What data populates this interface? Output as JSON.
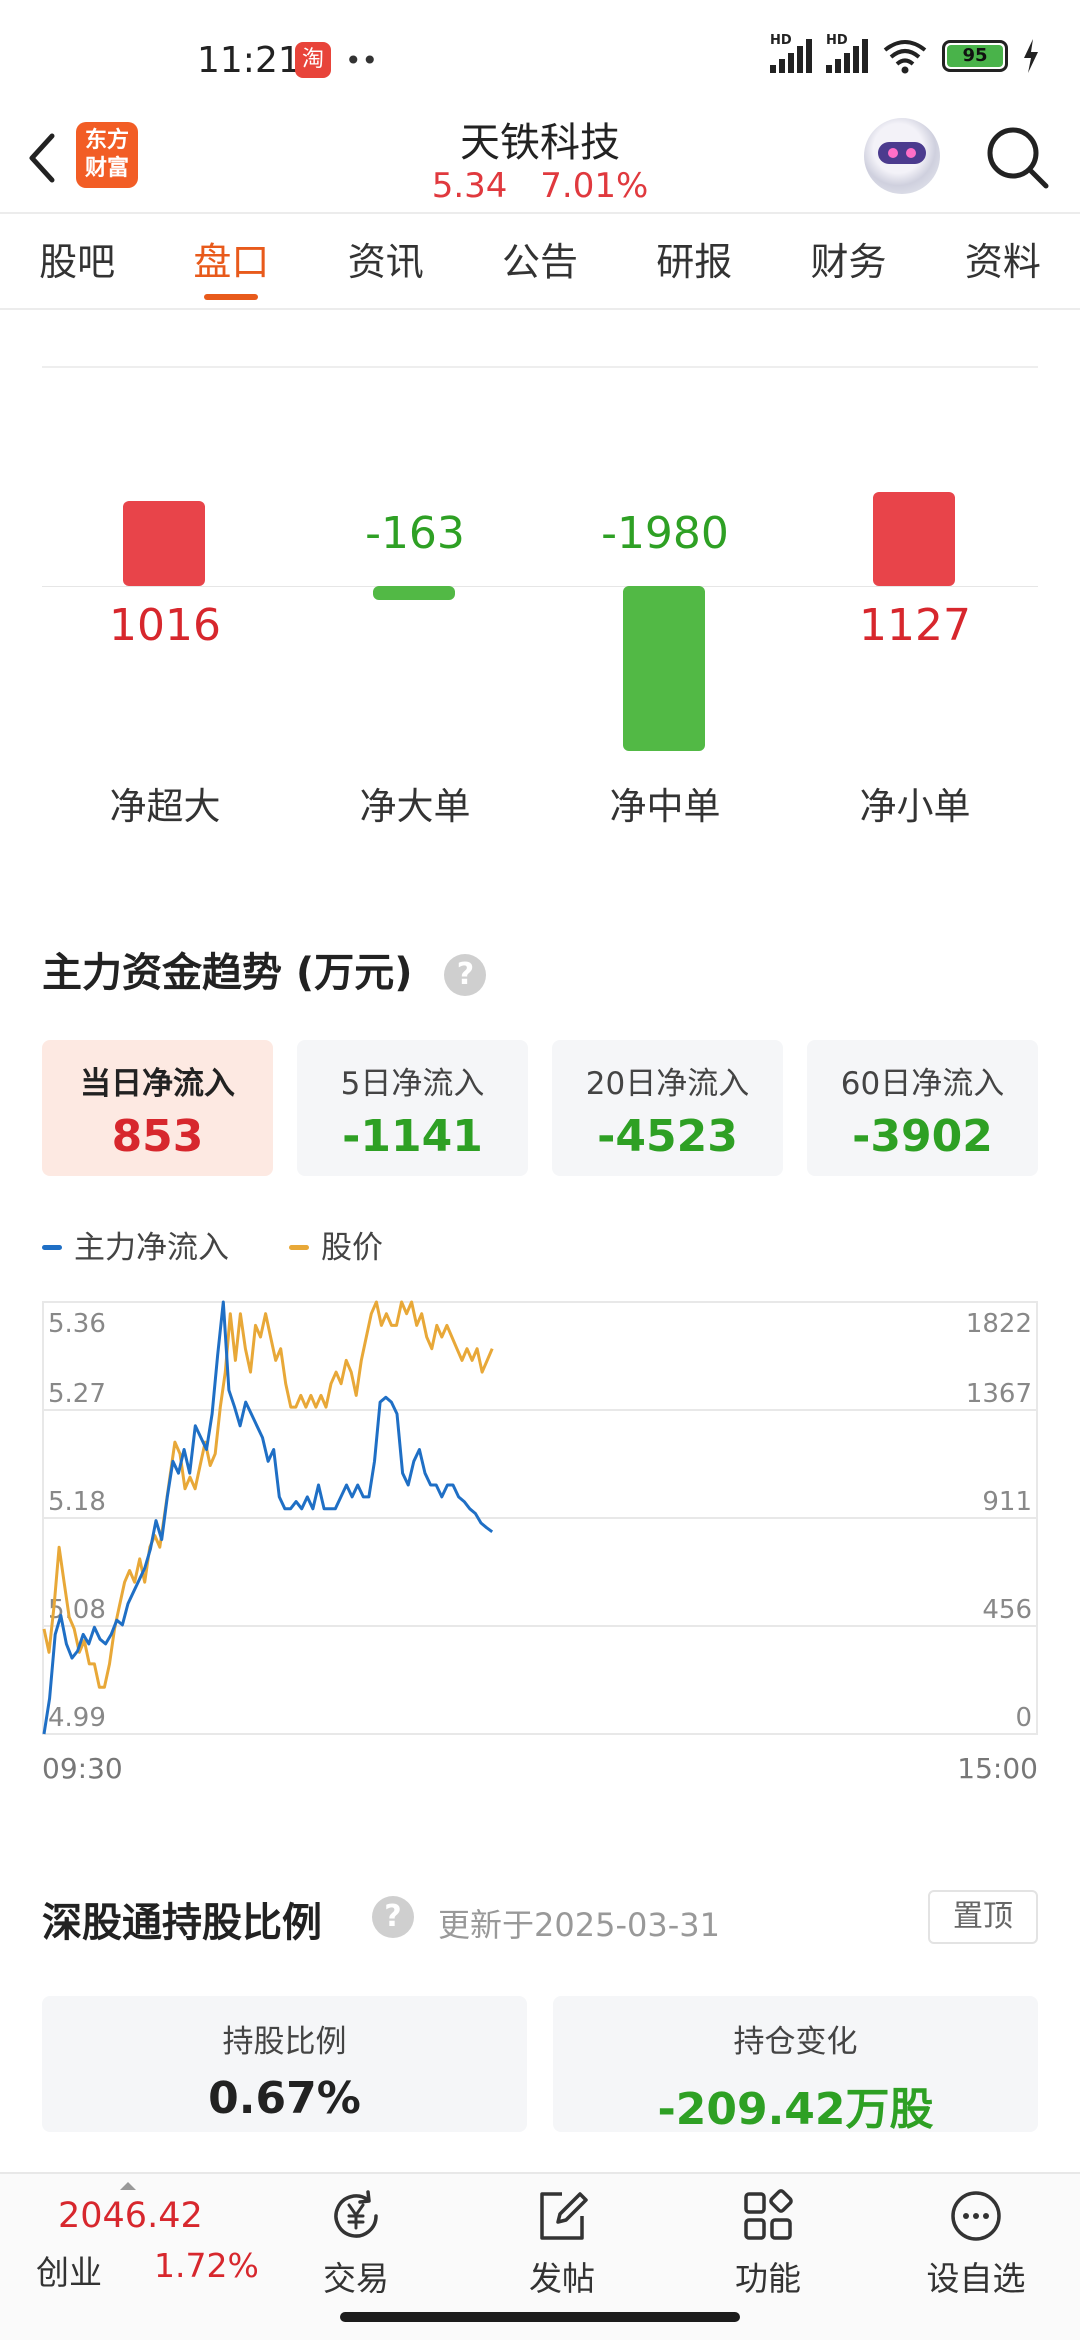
{
  "status_bar": {
    "time": "11:21",
    "app_icon": "淘",
    "dots": "••",
    "signal1_tag": "HD",
    "signal2_tag": "HD",
    "battery": "95",
    "icons": [
      "taobao-icon",
      "signal-icon",
      "signal-icon",
      "wifi-icon",
      "battery-icon",
      "charging-icon"
    ]
  },
  "header": {
    "brand_logo": "东方\n财富",
    "stock_name": "天铁科技",
    "price": "5.34",
    "change_pct": "7.01%",
    "icons": [
      "back-icon",
      "robot-avatar",
      "search-icon"
    ]
  },
  "tabs": [
    {
      "label": "股吧",
      "active": false
    },
    {
      "label": "盘口",
      "active": true
    },
    {
      "label": "资讯",
      "active": false
    },
    {
      "label": "公告",
      "active": false
    },
    {
      "label": "研报",
      "active": false
    },
    {
      "label": "财务",
      "active": false
    },
    {
      "label": "资料",
      "active": false
    }
  ],
  "flow": [
    {
      "label": "净超大",
      "value": "1016",
      "number": 1016,
      "sign": "pos"
    },
    {
      "label": "净大单",
      "value": "-163",
      "number": -163,
      "sign": "neg"
    },
    {
      "label": "净中单",
      "value": "-1980",
      "number": -1980,
      "sign": "neg"
    },
    {
      "label": "净小单",
      "value": "1127",
      "number": 1127,
      "sign": "pos"
    }
  ],
  "trend": {
    "title": "主力资金趋势 (万元)",
    "help": "?",
    "periods": [
      {
        "label": "当日净流入",
        "value": "853",
        "sign": "pos",
        "active": true
      },
      {
        "label": "5日净流入",
        "value": "-1141",
        "sign": "neg",
        "active": false
      },
      {
        "label": "20日净流入",
        "value": "-4523",
        "sign": "neg",
        "active": false
      },
      {
        "label": "60日净流入",
        "value": "-3902",
        "sign": "neg",
        "active": false
      }
    ],
    "legend": [
      {
        "label": "主力净流入",
        "color": "#1f6fc5"
      },
      {
        "label": "股价",
        "color": "#e8a838"
      }
    ],
    "time_start": "09:30",
    "time_end": "15:00"
  },
  "chart_data": {
    "type": "line",
    "xlabel": "",
    "ylabel": "",
    "x_range": [
      "09:30",
      "15:00"
    ],
    "ylim_left": [
      4.99,
      5.36
    ],
    "ylim_right": [
      0,
      1822
    ],
    "left_ticks": [
      "5.36",
      "5.27",
      "5.18",
      "5.08",
      "4.99"
    ],
    "right_ticks": [
      "1822",
      "1367",
      "911",
      "456",
      "0"
    ],
    "grid": true,
    "series": [
      {
        "name": "股价",
        "axis": "left",
        "color": "#e8a838",
        "values": [
          5.08,
          5.06,
          5.1,
          5.15,
          5.12,
          5.09,
          5.08,
          5.06,
          5.07,
          5.05,
          5.05,
          5.03,
          5.03,
          5.05,
          5.08,
          5.1,
          5.12,
          5.13,
          5.12,
          5.14,
          5.12,
          5.15,
          5.16,
          5.15,
          5.18,
          5.21,
          5.24,
          5.23,
          5.2,
          5.21,
          5.2,
          5.22,
          5.24,
          5.22,
          5.23,
          5.27,
          5.3,
          5.35,
          5.31,
          5.35,
          5.32,
          5.3,
          5.34,
          5.33,
          5.35,
          5.33,
          5.31,
          5.32,
          5.29,
          5.27,
          5.27,
          5.28,
          5.27,
          5.28,
          5.27,
          5.28,
          5.27,
          5.29,
          5.3,
          5.29,
          5.31,
          5.3,
          5.28,
          5.31,
          5.33,
          5.35,
          5.36,
          5.34,
          5.35,
          5.34,
          5.34,
          5.36,
          5.35,
          5.36,
          5.34,
          5.35,
          5.33,
          5.32,
          5.34,
          5.33,
          5.34,
          5.33,
          5.32,
          5.31,
          5.32,
          5.31,
          5.32,
          5.3,
          5.31,
          5.32
        ]
      },
      {
        "name": "主力净流入",
        "axis": "right",
        "color": "#1f6fc5",
        "values": [
          0,
          150,
          420,
          500,
          380,
          320,
          350,
          420,
          380,
          450,
          400,
          380,
          420,
          480,
          460,
          550,
          600,
          650,
          700,
          780,
          900,
          820,
          1000,
          1150,
          1100,
          1200,
          1100,
          1300,
          1250,
          1200,
          1350,
          1600,
          1822,
          1450,
          1380,
          1300,
          1400,
          1350,
          1300,
          1250,
          1150,
          1200,
          1000,
          950,
          950,
          980,
          950,
          1000,
          950,
          1050,
          950,
          950,
          950,
          1000,
          1050,
          1000,
          1050,
          1000,
          1000,
          1150,
          1400,
          1420,
          1400,
          1350,
          1100,
          1050,
          1150,
          1200,
          1100,
          1050,
          1050,
          1000,
          1050,
          1050,
          1000,
          980,
          950,
          930,
          890,
          870,
          853
        ]
      }
    ]
  },
  "hk_connect": {
    "title": "深股通持股比例",
    "help": "?",
    "updated": "更新于2025-03-31",
    "pin_label": "置顶",
    "cards": [
      {
        "label": "持股比例",
        "value": "0.67%",
        "sign": "neutral"
      },
      {
        "label": "持仓变化",
        "value": "-209.42万股",
        "sign": "neg"
      }
    ]
  },
  "bottom_nav": {
    "index_value": "2046.42",
    "index_name": "创业",
    "index_change": "1.72%",
    "items": [
      {
        "label": "交易",
        "icon": "yen-refresh-icon"
      },
      {
        "label": "发帖",
        "icon": "edit-icon"
      },
      {
        "label": "功能",
        "icon": "grid-icon"
      },
      {
        "label": "设自选",
        "icon": "more-icon"
      }
    ]
  }
}
